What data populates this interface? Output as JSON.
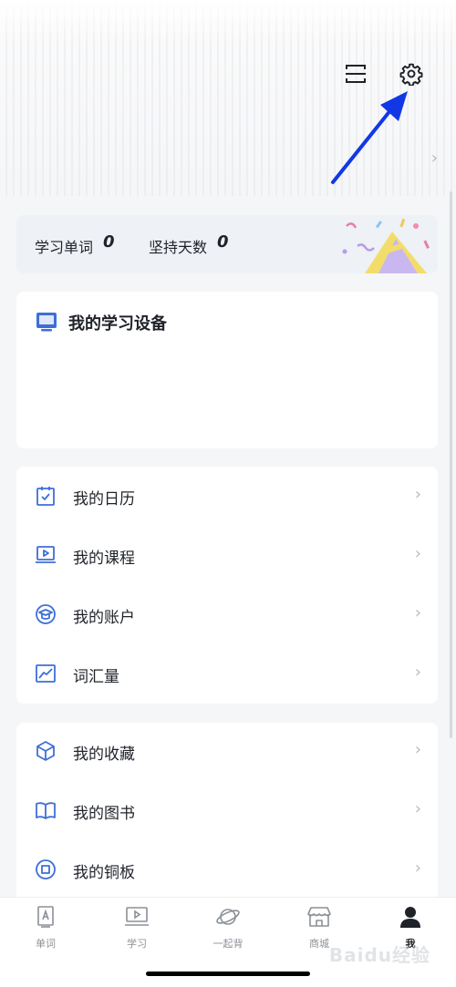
{
  "header": {
    "scan_icon": "scan-icon",
    "settings_icon": "gear-icon",
    "profile_chevron": "›"
  },
  "stats": {
    "words_label": "学习单词",
    "words_value": "0",
    "days_label": "坚持天数",
    "days_value": "0"
  },
  "devices": {
    "title": "我的学习设备"
  },
  "menu_group_1": [
    {
      "label": "我的日历",
      "icon": "calendar-icon"
    },
    {
      "label": "我的课程",
      "icon": "course-icon"
    },
    {
      "label": "我的账户",
      "icon": "account-icon"
    },
    {
      "label": "词汇量",
      "icon": "chart-icon"
    }
  ],
  "menu_group_2": [
    {
      "label": "我的收藏",
      "icon": "box-icon"
    },
    {
      "label": "我的图书",
      "icon": "book-icon"
    },
    {
      "label": "我的铜板",
      "icon": "coin-icon"
    }
  ],
  "tabs": [
    {
      "label": "单词",
      "icon": "word-card-icon"
    },
    {
      "label": "学习",
      "icon": "play-screen-icon"
    },
    {
      "label": "一起背",
      "icon": "planet-icon"
    },
    {
      "label": "商城",
      "icon": "store-icon"
    },
    {
      "label": "我",
      "icon": "person-icon"
    }
  ],
  "watermark": "Baidu经验",
  "colors": {
    "accent_blue": "#3e6fd8",
    "arrow_blue": "#1238e6",
    "background": "#f5f6f8"
  }
}
